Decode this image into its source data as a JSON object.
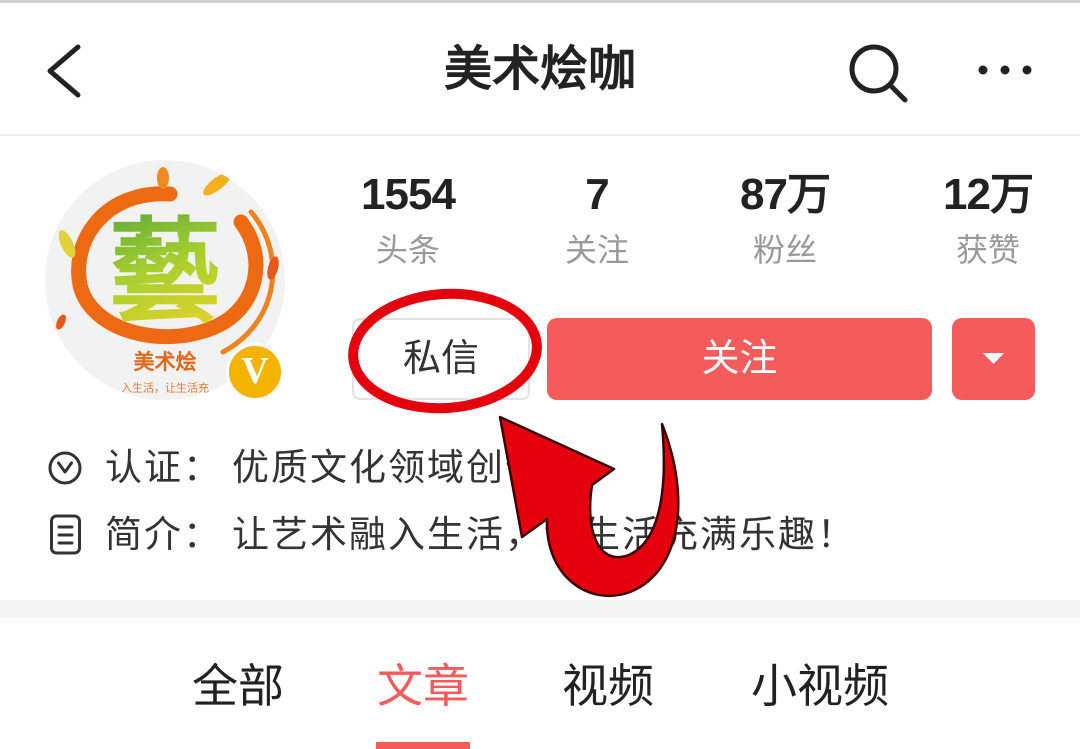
{
  "header": {
    "title": "美术烩咖",
    "icons": {
      "back": "chevron-left-icon",
      "search": "search-icon",
      "more": "more-horizontal-icon"
    }
  },
  "profile": {
    "avatar": {
      "logo_glyph": "藝",
      "logo_text": "美术烩",
      "logo_slogan": "入生活，让生活充",
      "badge_letter": "V"
    },
    "stats": [
      {
        "value": "1554",
        "label": "头条"
      },
      {
        "value": "7",
        "label": "关注"
      },
      {
        "value": "87万",
        "label": "粉丝"
      },
      {
        "value": "12万",
        "label": "获赞"
      }
    ],
    "actions": {
      "message_label": "私信",
      "follow_label": "关注",
      "dropdown_icon": "caret-down-icon"
    },
    "verification": {
      "icon": "verified-check-icon",
      "label": "认证：",
      "value": "优质文化领域创作者"
    },
    "bio": {
      "icon": "document-icon",
      "label": "简介：",
      "value": "让艺术融入生活，让生活充满乐趣！"
    }
  },
  "tabs": [
    {
      "label": "全部",
      "active": false
    },
    {
      "label": "文章",
      "active": true
    },
    {
      "label": "视频",
      "active": false
    },
    {
      "label": "小视频",
      "active": false
    }
  ],
  "colors": {
    "accent": "#f55b5b",
    "annotation": "#e5000e",
    "badge": "#f5b301",
    "text": "#222222",
    "muted": "#999999"
  }
}
